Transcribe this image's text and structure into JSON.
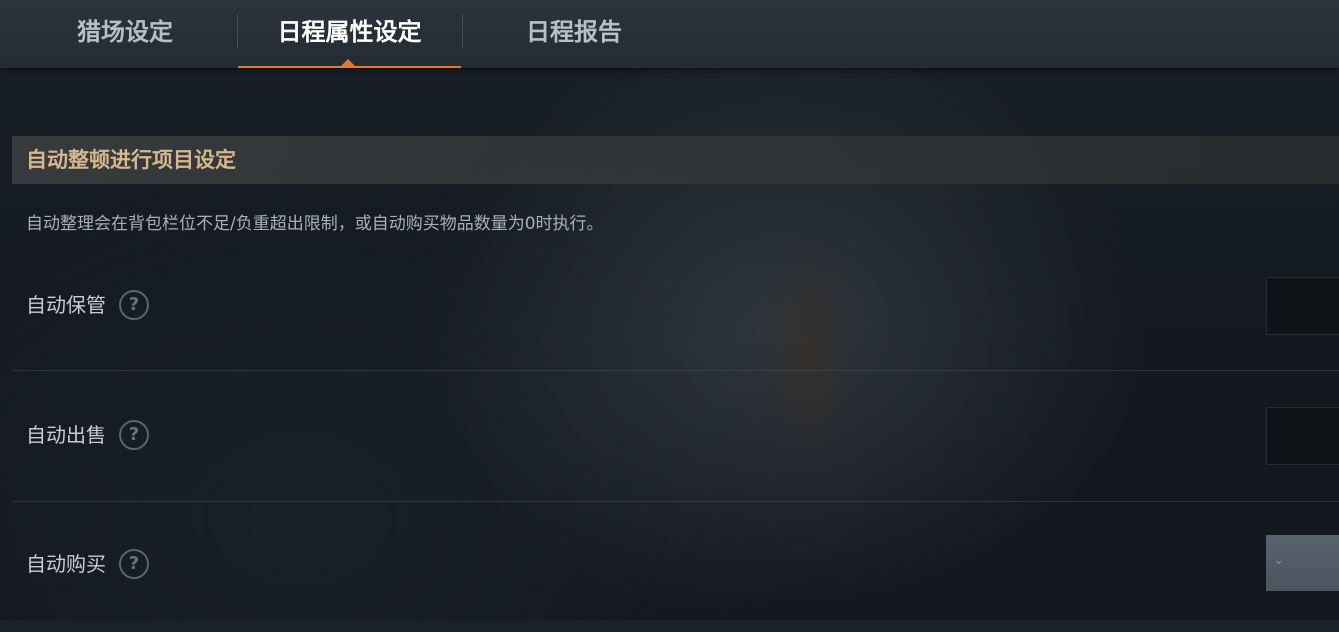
{
  "tabs": [
    {
      "label": "猎场设定",
      "active": false
    },
    {
      "label": "日程属性设定",
      "active": true
    },
    {
      "label": "日程报告",
      "active": false
    }
  ],
  "accent_color": "#e07a2e",
  "section": {
    "title": "自动整顿进行项目设定",
    "description": "自动整理会在背包栏位不足/负重超出限制，或自动购买物品数量为0时执行。"
  },
  "settings": [
    {
      "label": "自动保管",
      "help_icon": "question-circle-icon",
      "control": "toggle"
    },
    {
      "label": "自动出售",
      "help_icon": "question-circle-icon",
      "control": "toggle"
    },
    {
      "label": "自动购买",
      "help_icon": "question-circle-icon",
      "control": "dropdown"
    }
  ],
  "icons": {
    "help": "?",
    "chevron": "⌄"
  }
}
